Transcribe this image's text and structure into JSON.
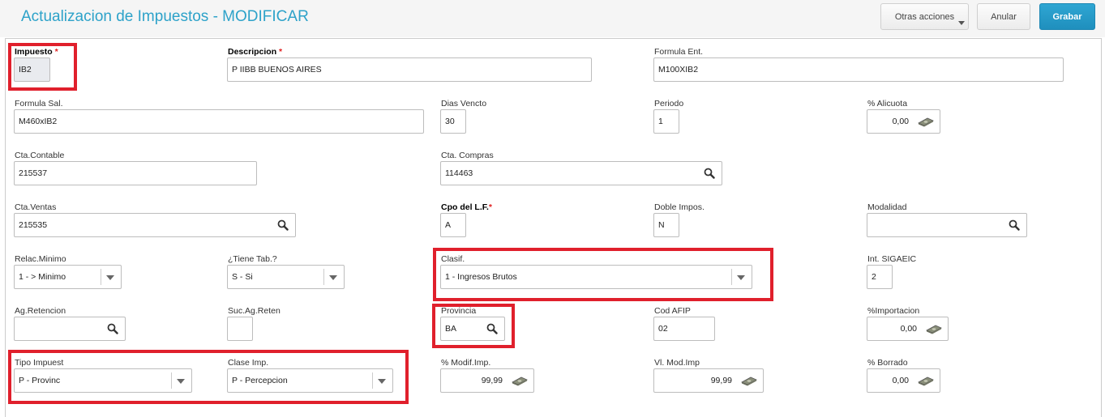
{
  "header": {
    "title": "Actualizacion de Impuestos - MODIFICAR",
    "buttons": {
      "otras_acciones": "Otras acciones",
      "anular": "Anular",
      "grabar": "Grabar"
    }
  },
  "form": {
    "impuesto": {
      "label": "Impuesto",
      "req": "*",
      "value": "IB2"
    },
    "descripcion": {
      "label": "Descripcion",
      "req": "*",
      "value": "P IIBB BUENOS AIRES"
    },
    "formula_ent": {
      "label": "Formula Ent.",
      "value": "M100XIB2"
    },
    "formula_sal": {
      "label": "Formula Sal.",
      "value": "M460xIB2"
    },
    "dias_vencto": {
      "label": "Dias Vencto",
      "value": "30"
    },
    "periodo": {
      "label": "Periodo",
      "value": "1"
    },
    "alicuota": {
      "label": "% Alicuota",
      "value": "0,00"
    },
    "cta_contable": {
      "label": "Cta.Contable",
      "value": "215537"
    },
    "cta_compras": {
      "label": "Cta. Compras",
      "value": "114463"
    },
    "cta_ventas": {
      "label": "Cta.Ventas",
      "value": "215535"
    },
    "cpo_lf": {
      "label": "Cpo del L.F.",
      "req": "*",
      "value": "A"
    },
    "doble_impos": {
      "label": "Doble Impos.",
      "value": "N"
    },
    "modalidad": {
      "label": "Modalidad",
      "value": ""
    },
    "relac_minimo": {
      "label": "Relac.Minimo",
      "value": "1 -  > Minimo"
    },
    "tiene_tab": {
      "label": "¿Tiene Tab.?",
      "value": "S -  Si"
    },
    "clasif": {
      "label": "Clasif.",
      "value": "1 - Ingresos Brutos"
    },
    "int_sigaeic": {
      "label": "Int. SIGAEIC",
      "value": "2"
    },
    "ag_retencion": {
      "label": "Ag.Retencion",
      "value": ""
    },
    "suc_ag_reten": {
      "label": "Suc.Ag.Reten",
      "value": ""
    },
    "provincia": {
      "label": "Provincia",
      "value": "BA"
    },
    "cod_afip": {
      "label": "Cod AFIP",
      "value": "02"
    },
    "importacion": {
      "label": "%Importacion",
      "value": "0,00"
    },
    "tipo_impuest": {
      "label": "Tipo Impuest",
      "value": "P - Provinc"
    },
    "clase_imp": {
      "label": "Clase Imp.",
      "value": "P - Percepcion"
    },
    "modif_imp": {
      "label": "% Modif.Imp.",
      "value": "99,99"
    },
    "vl_mod_imp": {
      "label": "Vl. Mod.Imp",
      "value": "99,99"
    },
    "borrado": {
      "label": "% Borrado",
      "value": "0,00"
    }
  },
  "colors": {
    "title": "#2da2c9",
    "primary": "#1f8fbd",
    "highlight": "#e0202c",
    "required": "#e02020"
  },
  "icons": {
    "search": "search-icon",
    "money": "money-icon",
    "dropdown": "chevron-down-icon"
  }
}
